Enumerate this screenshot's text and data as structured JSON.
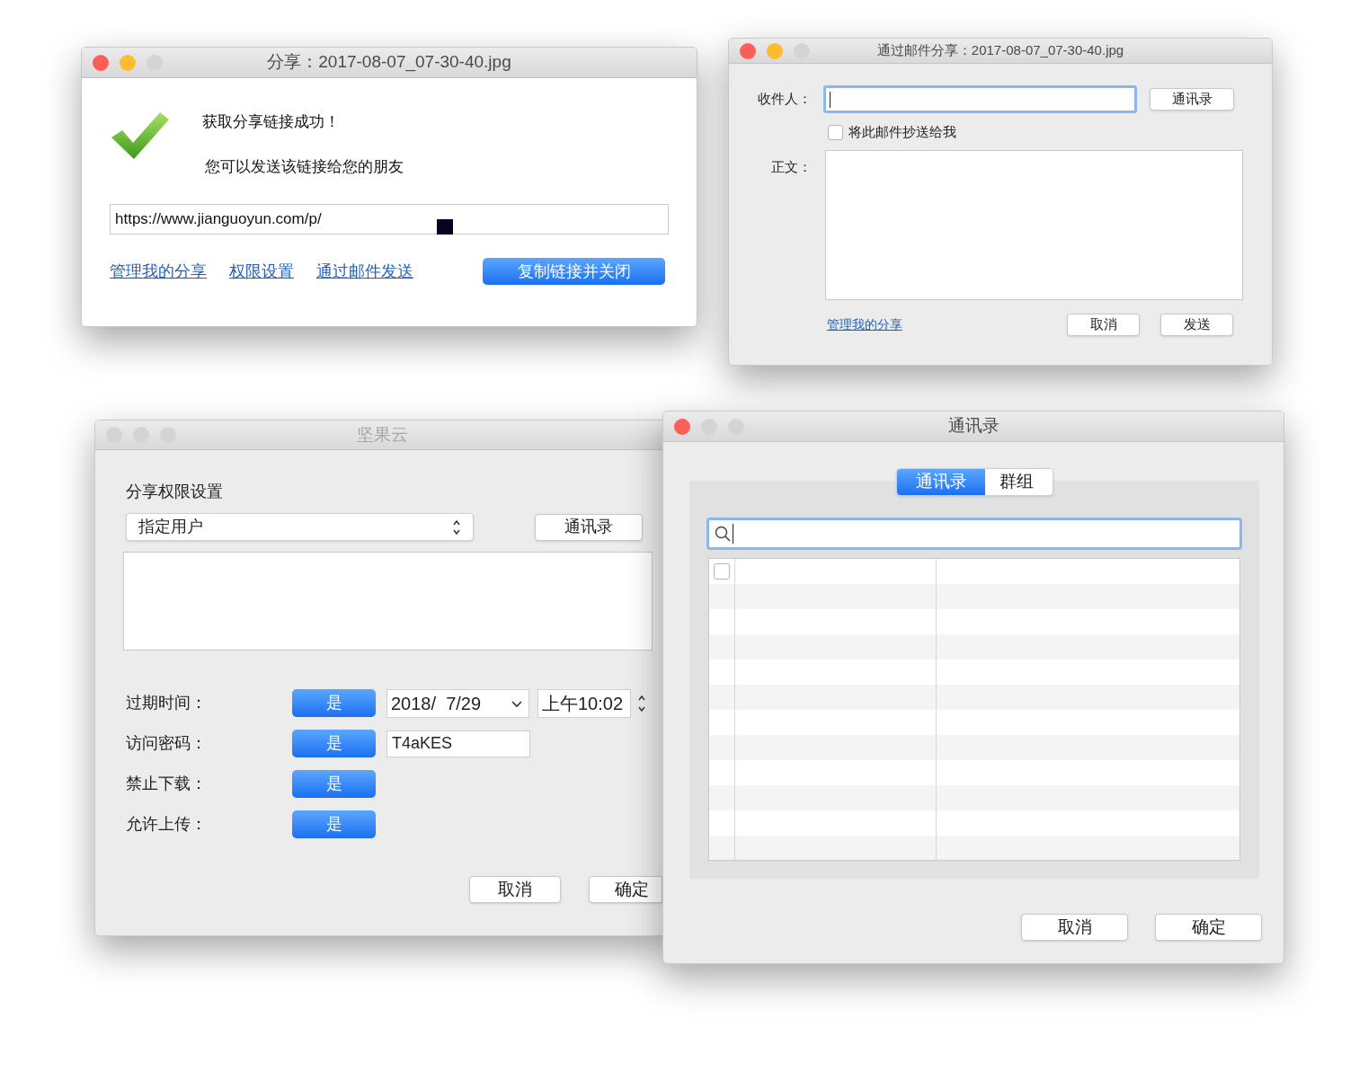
{
  "windows": [
    {
      "kind": "share_result",
      "title": "分享：2017-08-07_07-30-40.jpg",
      "lights": [
        {
          "color": "#fc5f57"
        },
        {
          "color": "#fdbc2e"
        },
        {
          "color": "#d4d4d4"
        }
      ],
      "heading": "获取分享链接成功！",
      "message": "您可以发送该链接给您的朋友",
      "link": "https://www.jianguoyun.com/p/",
      "links": [
        "管理我的分享",
        "权限设置",
        "通过邮件发送"
      ],
      "primary_button": "复制链接并关闭"
    },
    {
      "kind": "email_share",
      "title": "通过邮件分享：2017-08-07_07-30-40.jpg",
      "lights": [
        {
          "color": "#fc5f57"
        },
        {
          "color": "#fdbc2e"
        },
        {
          "color": "#d4d4d4"
        }
      ],
      "recipient_label": "收件人：",
      "contacts_button": "通讯录",
      "cc_me": {
        "label": "将此邮件抄送给我",
        "checked": false
      },
      "body_label": "正文：",
      "manage_link": "管理我的分享",
      "buttons": [
        "取消",
        "发送"
      ]
    },
    {
      "kind": "permissions",
      "title": "坚果云",
      "lights": [
        {
          "color": "#d4d4d4"
        },
        {
          "color": "#d4d4d4"
        },
        {
          "color": "#d4d4d4"
        }
      ],
      "heading": "分享权限设置",
      "scope_select": "指定用户",
      "contacts_button": "通讯录",
      "settings": [
        {
          "label": "过期时间：",
          "on": true,
          "toggle": "是",
          "kind": "date",
          "date": "2018/  7/29",
          "time": "上午10:02"
        },
        {
          "label": "访问密码：",
          "on": true,
          "toggle": "是",
          "kind": "text",
          "value": "T4aKES"
        },
        {
          "label": "禁止下载：",
          "on": true,
          "toggle": "是",
          "kind": "plain"
        },
        {
          "label": "允许上传：",
          "on": true,
          "toggle": "是",
          "kind": "plain"
        }
      ],
      "buttons": [
        "取消",
        "确定"
      ]
    },
    {
      "kind": "contacts",
      "title": "通讯录",
      "lights": [
        {
          "color": "#fc5f57"
        },
        {
          "color": "#d4d4d4"
        },
        {
          "color": "#d4d4d4"
        }
      ],
      "tabs": [
        {
          "label": "通讯录",
          "selected": true
        },
        {
          "label": "群组",
          "selected": false
        }
      ],
      "rows": [
        {
          "checked": false
        }
      ],
      "buttons": [
        "取消",
        "确定"
      ]
    }
  ]
}
